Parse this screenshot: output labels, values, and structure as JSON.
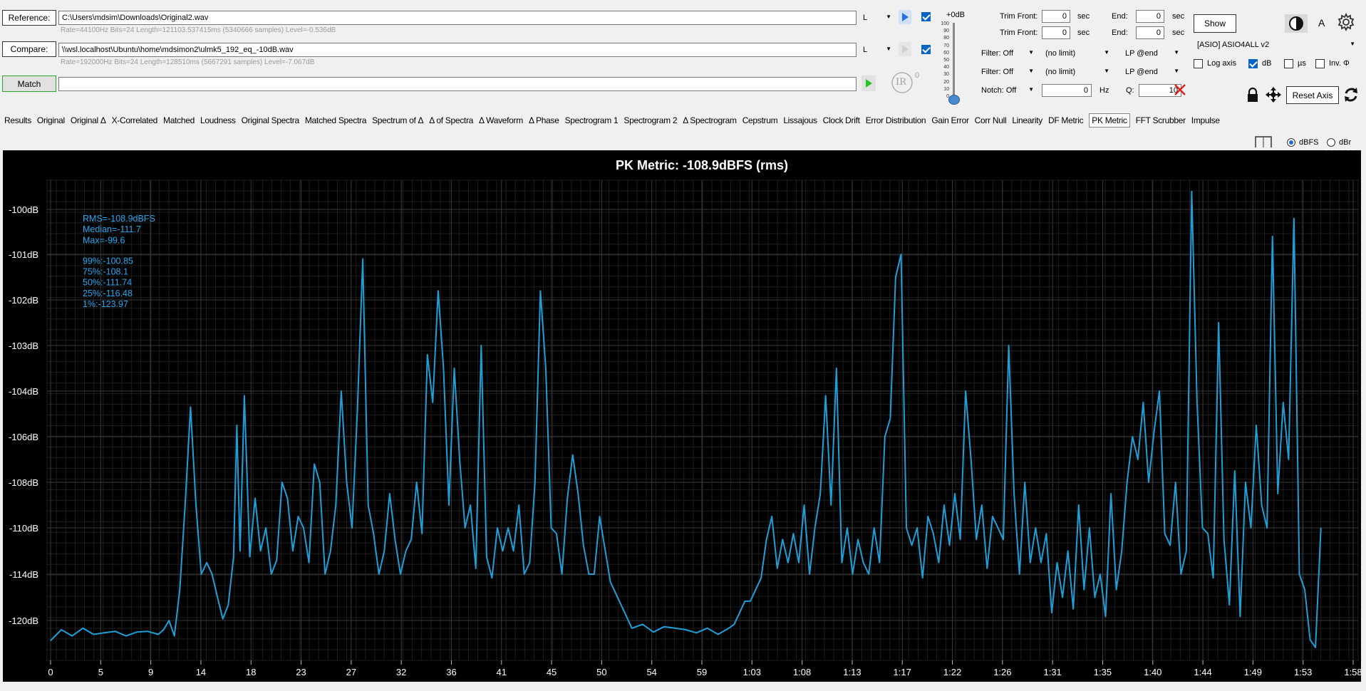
{
  "reference": {
    "button": "Reference:",
    "path": "C:\\Users\\mdsim\\Downloads\\Original2.wav",
    "info": "Rate=44100Hz Bits=24 Length=121103.537415ms (5340666 samples) Level=-0.536dB",
    "channel": "L"
  },
  "compare": {
    "button": "Compare:",
    "path": "\\\\wsl.localhost\\Ubuntu\\home\\mdsimon2\\ulmk5_192_eq_-10dB.wav",
    "info": "Rate=192000Hz Bits=24 Length=128510ms (5667291 samples) Level=-7.067dB",
    "channel": "L"
  },
  "match": {
    "button": "Match",
    "path": ""
  },
  "ir_badge": "IR",
  "ir_count": "0",
  "volume": {
    "top_label": "+0dB",
    "ticks": [
      "100",
      "90",
      "80",
      "70",
      "60",
      "50",
      "40",
      "30",
      "20",
      "10",
      "0"
    ]
  },
  "trim": {
    "row1": {
      "front_label": "Trim Front:",
      "front_value": "0",
      "front_unit": "sec",
      "end_label": "End:",
      "end_value": "0",
      "end_unit": "sec"
    },
    "row2": {
      "front_label": "Trim Front:",
      "front_value": "0",
      "front_unit": "sec",
      "end_label": "End:",
      "end_value": "0",
      "end_unit": "sec"
    }
  },
  "filters": {
    "row1": {
      "filter": "Filter: Off",
      "limit": "(no limit)",
      "lp": "LP @end"
    },
    "row2": {
      "filter": "Filter: Off",
      "limit": "(no limit)",
      "lp": "LP @end"
    },
    "notch": {
      "label": "Notch: Off",
      "freq": "0",
      "freq_unit": "Hz",
      "q_label": "Q:",
      "q_value": "10"
    }
  },
  "show_button": "Show",
  "font_toggle": "A",
  "device": "[ASIO] ASIO4ALL v2",
  "options": {
    "log_axis": "Log axis",
    "db": "dB",
    "us": "µs",
    "inv": "Inv. Φ"
  },
  "reset_axis": "Reset Axis",
  "tabs": [
    "Results",
    "Original",
    "Original Δ",
    "X-Correlated",
    "Matched",
    "Loudness",
    "Original Spectra",
    "Matched Spectra",
    "Spectrum of Δ",
    "Δ of Spectra",
    "Δ Waveform",
    "Δ Phase",
    "Spectrogram 1",
    "Spectrogram 2",
    "Δ Spectrogram",
    "Cepstrum",
    "Lissajous",
    "Clock Drift",
    "Error Distribution",
    "Gain Error",
    "Corr Null",
    "Linearity",
    "DF Metric",
    "PK Metric",
    "FFT Scrubber",
    "Impulse"
  ],
  "active_tab": "PK Metric",
  "units": {
    "dbfs": "dBFS",
    "dbr": "dBr"
  },
  "colors": {
    "plot_bg": "#000000",
    "trace": "#1f9fd8",
    "stats_text": "#1fa9ee",
    "grid": "#2c2c2c",
    "accent_blue": "#0a64c8",
    "play_green": "#22c422",
    "close_red": "#e02020"
  },
  "stats": {
    "rms": "RMS=-108.9dBFS",
    "median": "Median=-111.7",
    "max": "Max=-99.6",
    "p99": "99%:-100.85",
    "p75": "75%:-108.1",
    "p50": "50%:-111.74",
    "p25": "25%:-116.48",
    "p1": "1%:-123.97"
  },
  "chart_data": {
    "type": "line",
    "title": "PK Metric: -108.9dBFS (rms)",
    "xlabel": "",
    "ylabel": "",
    "x_ticks": [
      "0",
      "5",
      "9",
      "14",
      "18",
      "23",
      "27",
      "32",
      "36",
      "41",
      "45",
      "50",
      "54",
      "59",
      "1:03",
      "1:08",
      "1:13",
      "1:17",
      "1:22",
      "1:26",
      "1:31",
      "1:35",
      "1:40",
      "1:44",
      "1:49",
      "1:53",
      "1:58"
    ],
    "y_ticks": [
      "-100dB",
      "-101dB",
      "-102dB",
      "-103dB",
      "-104dB",
      "-106dB",
      "-108dB",
      "-110dB",
      "-114dB",
      "-120dB"
    ],
    "xlim_seconds": [
      0,
      121
    ],
    "grid": true,
    "series": [
      {
        "color": "#1f9fd8",
        "x_seconds": [
          0,
          1,
          2,
          3,
          4,
          5,
          6,
          7,
          8,
          9,
          10,
          10.5,
          11,
          11.5,
          12,
          12.5,
          13,
          13.5,
          14,
          14.5,
          15,
          15.5,
          16,
          16.5,
          17,
          17.3,
          17.6,
          18,
          18.5,
          19,
          19.5,
          20,
          20.5,
          21,
          21.5,
          22,
          22.5,
          23,
          23.5,
          24,
          24.5,
          25,
          25.5,
          26,
          26.5,
          27,
          27.5,
          28,
          28.5,
          29,
          29.5,
          30,
          30.5,
          31,
          31.5,
          32,
          32.5,
          33,
          33.5,
          34,
          34.5,
          35,
          35.5,
          36,
          36.5,
          37,
          37.5,
          38,
          38.5,
          39,
          39.5,
          40,
          40.5,
          41,
          41.5,
          42,
          42.5,
          43,
          43.5,
          44,
          44.5,
          45,
          45.5,
          46,
          46.5,
          47,
          47.5,
          48,
          48.5,
          49,
          49.5,
          50,
          50.5,
          51,
          52,
          53,
          54,
          55,
          56,
          57,
          58,
          59,
          60,
          61,
          62,
          63,
          63.5,
          64,
          64.5,
          65,
          65.5,
          66,
          66.5,
          67,
          67.5,
          68,
          68.5,
          69,
          69.5,
          70,
          70.5,
          71,
          71.5,
          72,
          72.5,
          73,
          73.5,
          74,
          74.5,
          75,
          75.5,
          76,
          76.5,
          77,
          77.5,
          78,
          78.5,
          79,
          79.5,
          80,
          80.5,
          81,
          81.5,
          82,
          82.5,
          83,
          83.5,
          84,
          84.5,
          85,
          85.5,
          86,
          86.5,
          87,
          87.5,
          88,
          88.5,
          89,
          89.5,
          90,
          90.5,
          91,
          91.5,
          92,
          92.5,
          93,
          93.5,
          94,
          94.5,
          95,
          95.5,
          96,
          96.5,
          97,
          97.5,
          98,
          98.5,
          99,
          99.5,
          100,
          100.5,
          101,
          101.5,
          102,
          102.5,
          103,
          103.5,
          104,
          104.5,
          105,
          105.5,
          106,
          106.5,
          107,
          107.5,
          108,
          108.5,
          109,
          109.5,
          110,
          110.5,
          111,
          111.5,
          112,
          112.5,
          113,
          113.5,
          114,
          114.5,
          115,
          115.5,
          116,
          116.5,
          117,
          117.5,
          118,
          118.5,
          119,
          119.5,
          120,
          120.5,
          121
        ],
        "y_db": [
          -122.6,
          -121.2,
          -122.0,
          -121.0,
          -121.8,
          -121.6,
          -121.4,
          -122.0,
          -121.5,
          -121.4,
          -121.8,
          -121.2,
          -120.0,
          -122.0,
          -116.0,
          -109.0,
          -104.7,
          -109.0,
          -114.0,
          -113.0,
          -114.0,
          -117.0,
          -119.8,
          -118.0,
          -112.5,
          -105.5,
          -112.0,
          -104.2,
          -112.5,
          -108.7,
          -112.0,
          -110.0,
          -114.0,
          -112.8,
          -108.0,
          -108.7,
          -112.0,
          -109.5,
          -110.0,
          -113.0,
          -107.2,
          -108.0,
          -114.0,
          -112.0,
          -109.0,
          -104.0,
          -108.0,
          -110.0,
          -104.8,
          -101.1,
          -109.0,
          -110.5,
          -114.0,
          -112.0,
          -108.5,
          -111.0,
          -114.0,
          -112.0,
          -111.0,
          -108.0,
          -110.5,
          -103.2,
          -104.5,
          -101.8,
          -103.5,
          -109.0,
          -103.5,
          -107.0,
          -110.0,
          -109.0,
          -113.5,
          -103.0,
          -112.5,
          -114.5,
          -110.0,
          -112.0,
          -110.0,
          -112.0,
          -109.0,
          -114.0,
          -113.0,
          -108.0,
          -101.8,
          -103.5,
          -110.0,
          -110.5,
          -114.0,
          -108.7,
          -106.8,
          -108.5,
          -111.5,
          -114.0,
          -114.0,
          -109.5,
          -115.0,
          -118.0,
          -121.0,
          -120.5,
          -121.5,
          -120.8,
          -121.0,
          -121.2,
          -121.6,
          -121.0,
          -121.8,
          -121.0,
          -120.5,
          -119.0,
          -117.5,
          -117.5,
          -116.0,
          -114.5,
          -111.0,
          -109.5,
          -113.5,
          -111.0,
          -113.0,
          -110.5,
          -113.0,
          -109.0,
          -114.0,
          -110.0,
          -108.5,
          -104.2,
          -109.0,
          -103.5,
          -113.0,
          -110.0,
          -114.0,
          -111.0,
          -113.0,
          -114.0,
          -110.0,
          -113.0,
          -106.0,
          -105.2,
          -101.5,
          -101.0,
          -110.0,
          -111.5,
          -110.0,
          -114.5,
          -109.5,
          -110.5,
          -113.0,
          -109.0,
          -111.5,
          -108.5,
          -111.0,
          -104.0,
          -107.0,
          -111.0,
          -109.0,
          -113.5,
          -109.5,
          -110.0,
          -111.0,
          -103.0,
          -108.5,
          -114.0,
          -108.0,
          -113.0,
          -110.0,
          -113.0,
          -110.5,
          -119.0,
          -113.0,
          -117.0,
          -112.0,
          -118.5,
          -109.0,
          -116.0,
          -110.0,
          -117.0,
          -114.0,
          -119.5,
          -108.5,
          -116.0,
          -112.0,
          -108.0,
          -106.0,
          -107.0,
          -104.5,
          -108.0,
          -105.8,
          -104.0,
          -110.5,
          -111.5,
          -108.0,
          -114.0,
          -112.0,
          -99.6,
          -104.5,
          -110.0,
          -110.5,
          -114.5,
          -102.5,
          -111.0,
          -118.0,
          -107.5,
          -119.5,
          -108.0,
          -110.0,
          -105.5,
          -109.0,
          -110.0,
          -100.6,
          -108.5,
          -104.5,
          -107.0,
          -100.2,
          -114.0,
          -116.0,
          -122.5,
          -123.5,
          -110.0
        ]
      }
    ]
  }
}
